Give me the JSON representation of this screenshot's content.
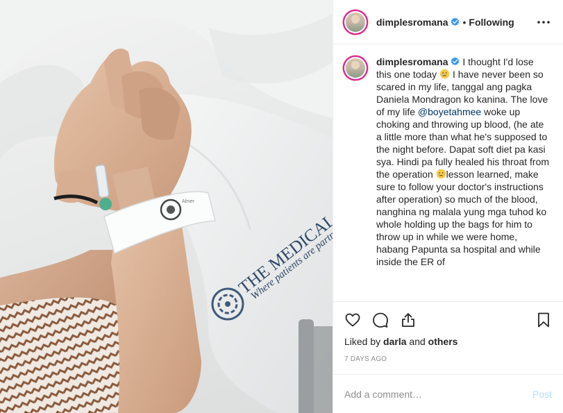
{
  "photo": {
    "pillow_text_1": "THE MEDICAL CITY",
    "pillow_text_2": "Where patients are partners",
    "wristband_text": "Almer"
  },
  "header": {
    "username": "dimplesromana",
    "separator": "•",
    "follow_status": "Following",
    "more_icon": "more-horizontal-icon",
    "verified_icon": "verified-badge-icon"
  },
  "caption": {
    "username": "dimplesromana",
    "text_1": "I thought I'd lose this one today",
    "text_2": "I have never been so scared in my life, tanggal ang pagka Daniela Mondragon ko kanina. The love of my life",
    "mention": "@boyetahmee",
    "text_3": "woke up choking and throwing up blood, (he ate a little more than what he's supposed to the night before. Dapat soft diet pa kasi sya. Hindi pa fully healed his throat from the operation",
    "text_4": "lesson learned, make sure to follow your doctor's instructions after operation) so much of the blood, nanghina ng malala yung mga tuhod ko whole holding up the bags for him to throw up in while we were home, habang Papunta sa hospital and while inside the ER of",
    "emoji_icon": "crying-face-icon"
  },
  "actions": {
    "like_icon": "heart-icon",
    "comment_icon": "comment-icon",
    "share_icon": "share-icon",
    "save_icon": "bookmark-icon"
  },
  "likes": {
    "prefix": "Liked by",
    "user": "darla",
    "and": "and",
    "others": "others"
  },
  "date": "7 DAYS AGO",
  "comment_box": {
    "placeholder": "Add a comment…",
    "post_label": "Post"
  },
  "colors": {
    "accent_link": "#003569",
    "verified_blue": "#3897f0",
    "post_disabled": "#b2dffc",
    "muted": "#8e8e8e"
  }
}
